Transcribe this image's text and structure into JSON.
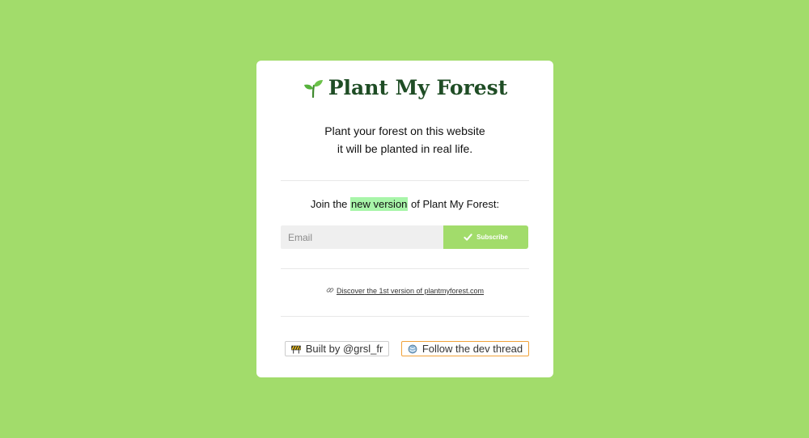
{
  "card": {
    "title": "Plant My Forest",
    "tagline_line1": "Plant your forest on this website",
    "tagline_line2": "it will be planted in real life."
  },
  "join": {
    "prefix": "Join the ",
    "highlight": "new version",
    "suffix": " of Plant My Forest:"
  },
  "form": {
    "email_placeholder": "Email",
    "subscribe_label": "Subscribe"
  },
  "discover": {
    "link_text": "Discover the 1st version of plantmyforest.com"
  },
  "footer": {
    "built_label": "Built by @grsl_fr",
    "follow_label": "Follow the dev thread"
  },
  "icons": {
    "title": "sprout-icon",
    "subscribe": "check-icon",
    "discover": "link-icon",
    "built": "construction-icon",
    "follow": "thread-icon"
  },
  "colors": {
    "background": "#a2dc6b",
    "card": "#ffffff",
    "title": "#1f4d25",
    "accent": "#a2dc6b",
    "highlight": "#a8f5a9",
    "follow_border": "#f0a23a"
  }
}
